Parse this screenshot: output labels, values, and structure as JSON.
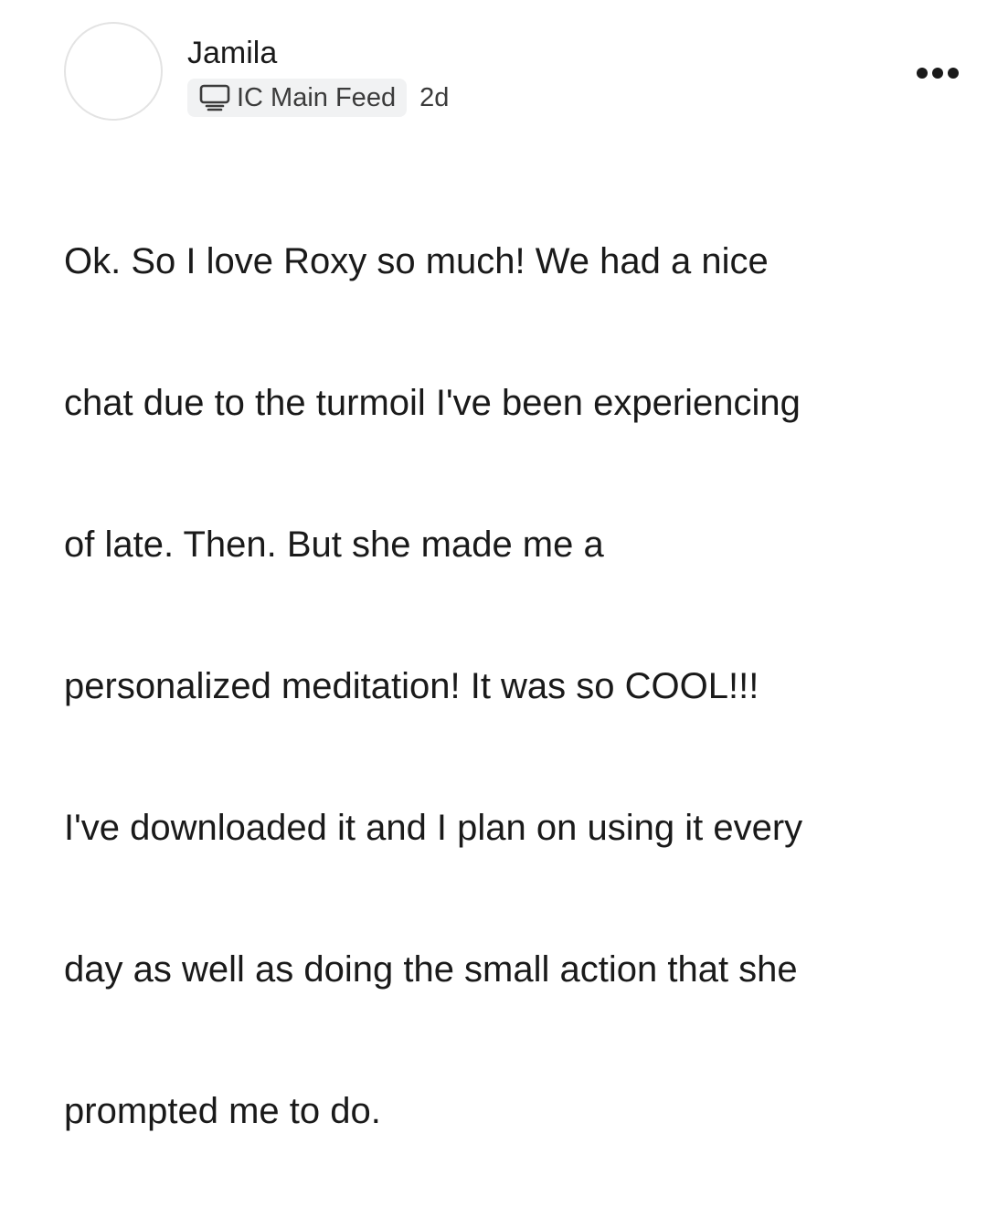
{
  "post": {
    "author": {
      "name": "Jamila"
    },
    "channel": {
      "icon": "feed-icon",
      "label": "IC Main Feed"
    },
    "timestamp": "2d",
    "more_icon": "more-horizontal-icon",
    "body_lines": [
      "Ok. So I love Roxy so much! We had a nice",
      "chat due to the turmoil I've been experiencing",
      "of late. Then. But she made me a",
      "personalized meditation! It was so COOL!!!",
      "I've downloaded it and I plan on using it every",
      "day as well as doing the small action that she",
      "prompted me to do."
    ]
  },
  "colors": {
    "text": "#1a1a1a",
    "meta_text": "#3b3b3b",
    "pill_bg": "#f1f2f3",
    "avatar_border": "#e3e3e3"
  }
}
